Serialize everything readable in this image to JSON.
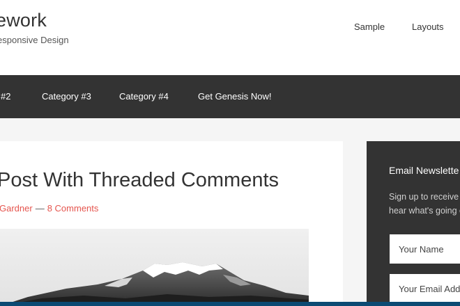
{
  "header": {
    "site_title": "ework",
    "site_description": "esponsive Design",
    "nav": [
      "Sample",
      "Layouts"
    ]
  },
  "primary_nav": {
    "items": [
      "#2",
      "Category #3",
      "Category #4",
      "Get Genesis Now!"
    ]
  },
  "post": {
    "title": "Post With Threaded Comments",
    "author": "Gardner",
    "separator": "—",
    "comments": "8 Comments",
    "image": "mountain-photo"
  },
  "sidebar": {
    "widget_title": "Email Newslette",
    "text_lines": [
      "Sign up to receive e",
      "hear what's going o"
    ],
    "name_placeholder": "Your Name",
    "email_placeholder": "Your Email Addr"
  },
  "colors": {
    "nav_bg": "#333333",
    "accent": "#e5554e",
    "page_bg": "#f5f5f5",
    "bottom_bar": "#0b4a73"
  }
}
